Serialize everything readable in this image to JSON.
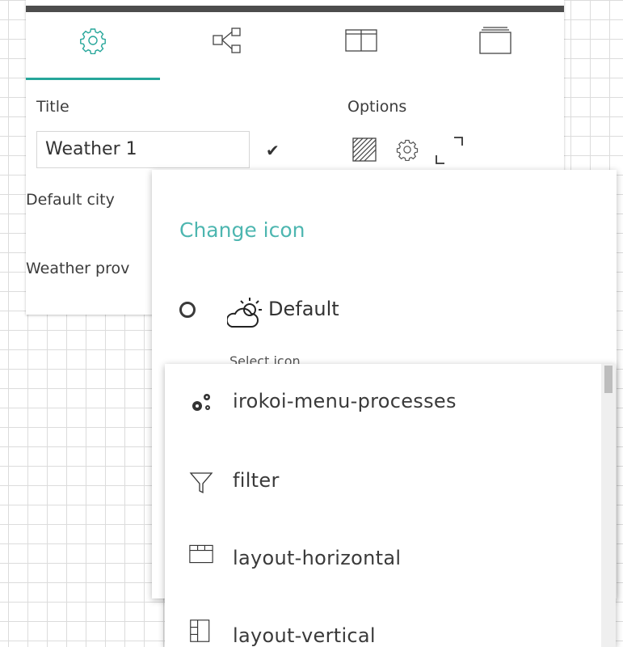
{
  "colors": {
    "accent": "#26a69a",
    "accent_text": "#4db6b0",
    "topbar": "#4d4d4d"
  },
  "tabs": [
    {
      "name": "settings",
      "icon": "gear-icon",
      "active": true
    },
    {
      "name": "connections",
      "icon": "share-nodes-icon",
      "active": false
    },
    {
      "name": "layout",
      "icon": "columns-icon",
      "active": false
    },
    {
      "name": "stack",
      "icon": "stack-icon",
      "active": false
    }
  ],
  "form": {
    "title_label": "Title",
    "title_value": "Weather 1",
    "options_label": "Options",
    "default_city_label": "Default city",
    "weather_provider_label": "Weather prov"
  },
  "popover": {
    "title": "Change icon",
    "default_option_label": "Default",
    "select_label": "Select icon"
  },
  "icon_list": [
    {
      "label": "irokoi-menu-processes",
      "icon": "gears-icon"
    },
    {
      "label": "filter",
      "icon": "filter-icon"
    },
    {
      "label": "layout-horizontal",
      "icon": "layout-horizontal-icon"
    },
    {
      "label": "layout-vertical",
      "icon": "layout-vertical-icon"
    }
  ]
}
